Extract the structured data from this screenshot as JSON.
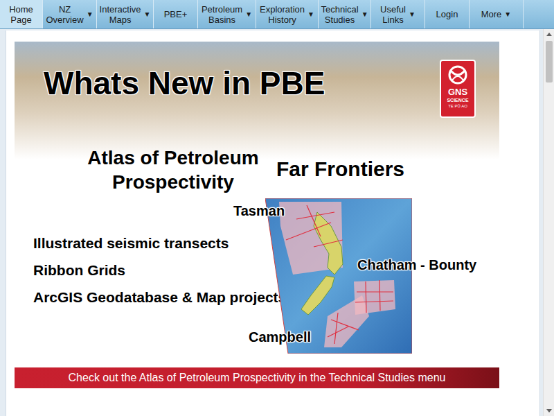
{
  "nav": [
    {
      "lines": [
        "Home",
        "Page"
      ],
      "selected": true,
      "dropdown": false
    },
    {
      "lines": [
        "NZ",
        "Overview"
      ],
      "selected": false,
      "dropdown": true
    },
    {
      "lines": [
        "Interactive",
        "Maps"
      ],
      "selected": false,
      "dropdown": true
    },
    {
      "lines": [
        "PBE+"
      ],
      "selected": false,
      "dropdown": false
    },
    {
      "lines": [
        "Petroleum",
        "Basins"
      ],
      "selected": false,
      "dropdown": true
    },
    {
      "lines": [
        "Exploration",
        "History"
      ],
      "selected": false,
      "dropdown": true
    },
    {
      "lines": [
        "Technical",
        "Studies"
      ],
      "selected": false,
      "dropdown": true
    },
    {
      "lines": [
        "Useful",
        "Links"
      ],
      "selected": false,
      "dropdown": true
    },
    {
      "lines": [
        "Login"
      ],
      "selected": false,
      "dropdown": false
    },
    {
      "lines": [
        "More"
      ],
      "selected": false,
      "dropdown": true
    }
  ],
  "dropdown_glyph": "▼",
  "banner": {
    "title": "Whats New in PBE",
    "logo": {
      "lines": [
        "GNS",
        "SCIENCE",
        "TE PŪ AO"
      ]
    },
    "left_heading": [
      "Atlas of Petroleum",
      "Prospectivity"
    ],
    "right_heading": "Far Frontiers",
    "features": [
      "Illustrated seismic transects",
      "Ribbon Grids",
      "ArcGIS Geodatabase & Map projects"
    ],
    "map_labels": {
      "tasman": "Tasman",
      "chatham": "Chatham - Bounty",
      "campbell": "Campbell"
    },
    "footer": "Check out the Atlas of Petroleum Prospectivity in the Technical Studies menu"
  }
}
